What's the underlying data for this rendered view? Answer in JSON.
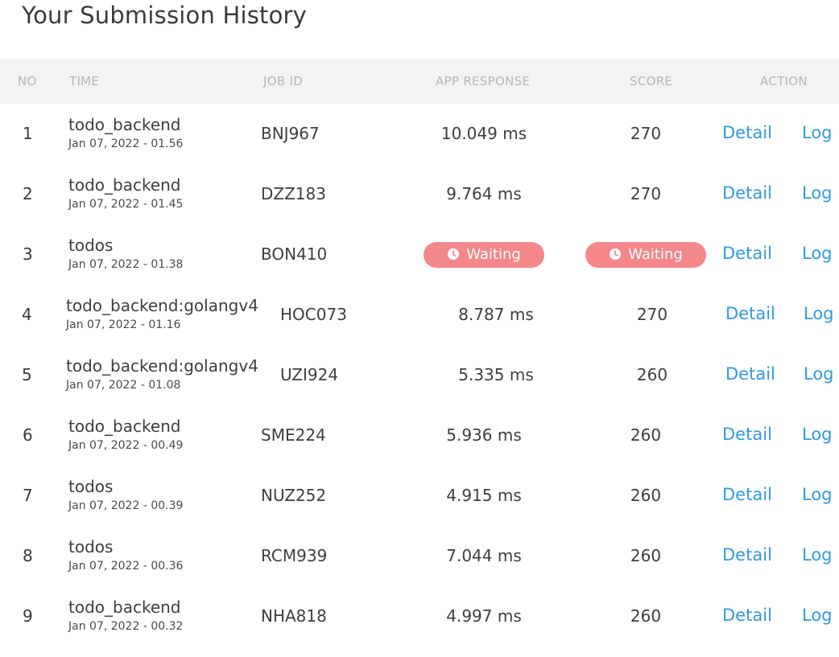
{
  "page": {
    "title": "Your Submission History"
  },
  "table": {
    "headers": {
      "no": "NO",
      "time": "TIME",
      "job_id": "JOB ID",
      "app_response": "APP RESPONSE",
      "score": "SCORE",
      "action": "ACTION"
    },
    "detail_label": "Detail",
    "log_label": "Log",
    "waiting_label": "Waiting",
    "rows": [
      {
        "no": "1",
        "name": "todo_backend",
        "date": "Jan 07, 2022 - 01.56",
        "job_id": "BNJ967",
        "app_response": "10.049 ms",
        "score": "270",
        "waiting": false
      },
      {
        "no": "2",
        "name": "todo_backend",
        "date": "Jan 07, 2022 - 01.45",
        "job_id": "DZZ183",
        "app_response": "9.764 ms",
        "score": "270",
        "waiting": false
      },
      {
        "no": "3",
        "name": "todos",
        "date": "Jan 07, 2022 - 01.38",
        "job_id": "BON410",
        "app_response": "Waiting",
        "score": "Waiting",
        "waiting": true
      },
      {
        "no": "4",
        "name": "todo_backend:golangv4",
        "date": "Jan 07, 2022 - 01.16",
        "job_id": "HOC073",
        "app_response": "8.787 ms",
        "score": "270",
        "waiting": false
      },
      {
        "no": "5",
        "name": "todo_backend:golangv4",
        "date": "Jan 07, 2022 - 01.08",
        "job_id": "UZI924",
        "app_response": "5.335 ms",
        "score": "260",
        "waiting": false
      },
      {
        "no": "6",
        "name": "todo_backend",
        "date": "Jan 07, 2022 - 00.49",
        "job_id": "SME224",
        "app_response": "5.936 ms",
        "score": "260",
        "waiting": false
      },
      {
        "no": "7",
        "name": "todos",
        "date": "Jan 07, 2022 - 00.39",
        "job_id": "NUZ252",
        "app_response": "4.915 ms",
        "score": "260",
        "waiting": false
      },
      {
        "no": "8",
        "name": "todos",
        "date": "Jan 07, 2022 - 00.36",
        "job_id": "RCM939",
        "app_response": "7.044 ms",
        "score": "260",
        "waiting": false
      },
      {
        "no": "9",
        "name": "todo_backend",
        "date": "Jan 07, 2022 - 00.32",
        "job_id": "NHA818",
        "app_response": "4.997 ms",
        "score": "260",
        "waiting": false
      }
    ]
  },
  "colors": {
    "link": "#2f9be0",
    "waiting_badge": "#f3878a",
    "header_bg": "#f3f3f3",
    "header_text": "#b5b5b5"
  },
  "icons": {
    "waiting": "clock-icon"
  }
}
